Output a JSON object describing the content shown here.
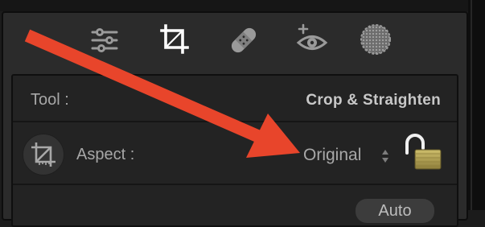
{
  "toolbar": {
    "tools": [
      {
        "icon": "sliders-icon"
      },
      {
        "icon": "crop-icon",
        "active": true
      },
      {
        "icon": "bandage-icon"
      },
      {
        "icon": "redeye-icon"
      },
      {
        "icon": "mask-icon"
      }
    ]
  },
  "crop_panel": {
    "tool_label": "Tool :",
    "tool_value": "Crop & Straighten",
    "aspect_label": "Aspect :",
    "aspect_value": "Original",
    "auto_label": "Auto"
  },
  "annotation": {
    "arrow_color": "#e8452b"
  },
  "colors": {
    "panel_bg": "#2b2b2b",
    "section_bg": "#232323",
    "lock_gold": "#b5a55c"
  }
}
